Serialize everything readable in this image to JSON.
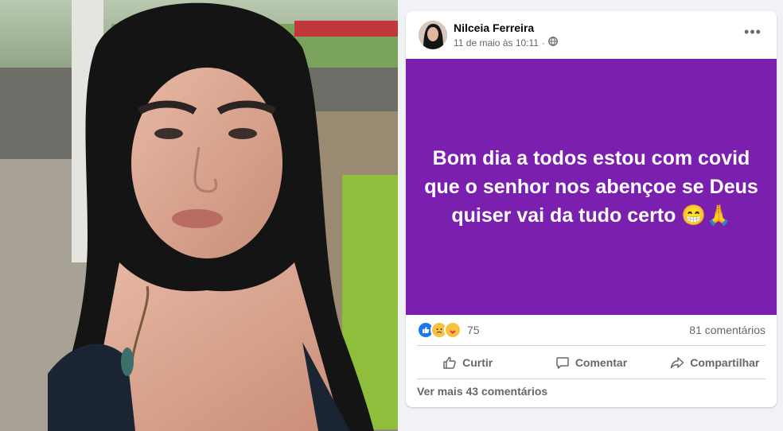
{
  "post": {
    "author": "Nilceia Ferreira",
    "timestamp": "11 de maio às 10:11",
    "separator": "·",
    "privacy_icon": "globe-icon",
    "more_icon": "ellipsis-icon",
    "more_label": "•••",
    "banner_color": "#7a1fae",
    "text": "Bom dia a todos estou com covid que o senhor nos abençoe se Deus quiser vai da tudo certo 😁🙏"
  },
  "reactions": {
    "icons": [
      "like-icon",
      "sad-icon",
      "care-icon"
    ],
    "count": "75",
    "comments": "81 comentários"
  },
  "actions": [
    {
      "label": "Curtir",
      "icon": "thumbs-up-icon"
    },
    {
      "label": "Comentar",
      "icon": "comment-icon"
    },
    {
      "label": "Compartilhar",
      "icon": "share-icon"
    }
  ],
  "footer": {
    "more_comments": "Ver mais 43 comentários"
  }
}
